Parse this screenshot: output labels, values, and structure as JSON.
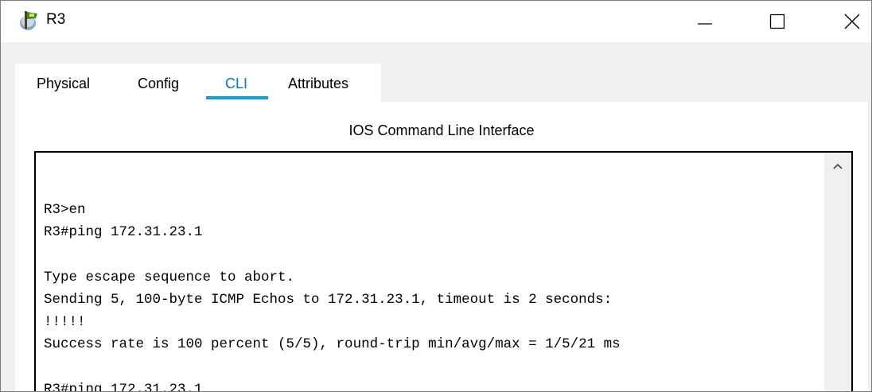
{
  "window": {
    "title": "R3",
    "icon": "router-app-icon",
    "controls": {
      "minimize_icon": "minimize-icon",
      "maximize_icon": "maximize-icon",
      "close_icon": "close-icon"
    }
  },
  "tabs": [
    {
      "label": "Physical",
      "active": false
    },
    {
      "label": "Config",
      "active": false
    },
    {
      "label": "CLI",
      "active": true
    },
    {
      "label": "Attributes",
      "active": false
    }
  ],
  "colors": {
    "active_tab_text": "#0078d7",
    "active_tab_underline": "#0aa0e6",
    "window_bg": "#f0f0f0",
    "panel_bg": "#ffffff"
  },
  "cli": {
    "heading": "IOS Command Line Interface",
    "lines": [
      "R3>en",
      "R3#ping 172.31.23.1",
      "",
      "Type escape sequence to abort.",
      "Sending 5, 100-byte ICMP Echos to 172.31.23.1, timeout is 2 seconds:",
      "!!!!!",
      "Success rate is 100 percent (5/5), round-trip min/avg/max = 1/5/21 ms",
      "",
      "R3#ping 172.31.23.1"
    ],
    "scroll_up_icon": "chevron-up-icon"
  }
}
